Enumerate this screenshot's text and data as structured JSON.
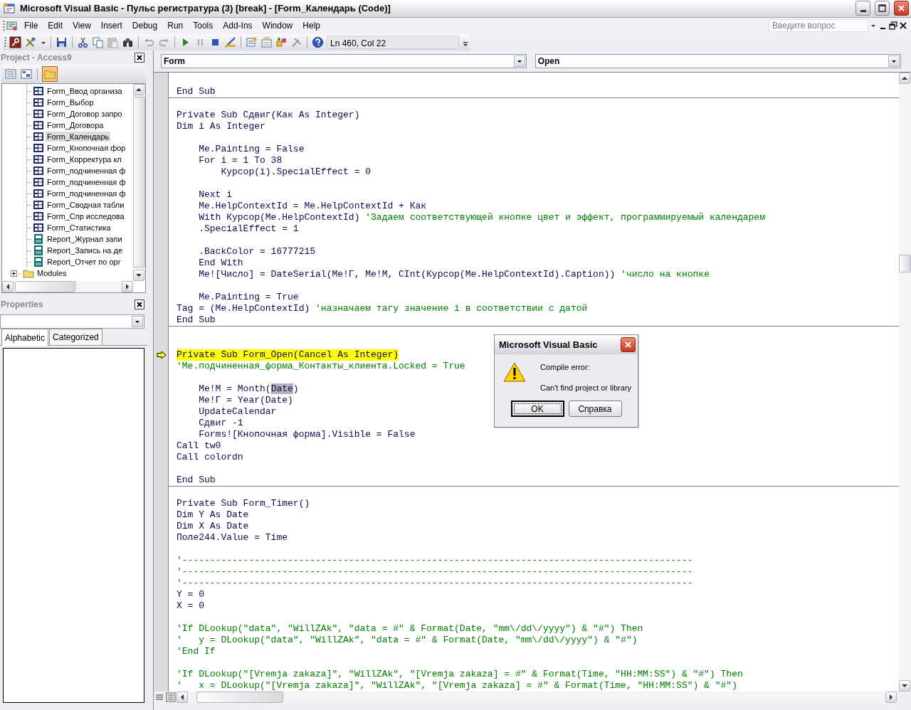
{
  "window": {
    "title": "Microsoft Visual Basic - Пульс регистратура (3) [break] - [Form_Календарь (Code)]"
  },
  "menu": [
    "File",
    "Edit",
    "View",
    "Insert",
    "Debug",
    "Run",
    "Tools",
    "Add-Ins",
    "Window",
    "Help"
  ],
  "help_search": {
    "placeholder": "Введите вопрос"
  },
  "toolbar": {
    "position": "Ln 460, Col 22"
  },
  "project_panel": {
    "title": "Project - Access9",
    "folders_toggled": true,
    "tree": [
      {
        "kind": "offscreen",
        "children": [
          {
            "kind": "form",
            "label": "Form_Ввод организа",
            "selected": false
          },
          {
            "kind": "form",
            "label": "Form_Выбор",
            "selected": false
          },
          {
            "kind": "form",
            "label": "Form_Договор запро",
            "selected": false
          },
          {
            "kind": "form",
            "label": "Form_Договора",
            "selected": false
          },
          {
            "kind": "form",
            "label": "Form_Календарь",
            "selected": true
          },
          {
            "kind": "form",
            "label": "Form_Кнопочная фор",
            "selected": false
          },
          {
            "kind": "form",
            "label": "Form_Корректура кл",
            "selected": false
          },
          {
            "kind": "form",
            "label": "Form_подчиненная ф",
            "selected": false
          },
          {
            "kind": "form",
            "label": "Form_подчиненная ф",
            "selected": false
          },
          {
            "kind": "form",
            "label": "Form_подчиненная ф",
            "selected": false
          },
          {
            "kind": "form",
            "label": "Form_Сводная табли",
            "selected": false
          },
          {
            "kind": "form",
            "label": "Form_Спр исследова",
            "selected": false
          },
          {
            "kind": "form",
            "label": "Form_Статистика",
            "selected": false
          },
          {
            "kind": "report",
            "label": "Report_Журнал запи",
            "selected": false
          },
          {
            "kind": "report",
            "label": "Report_Запись на де",
            "selected": false
          },
          {
            "kind": "report",
            "label": "Report_Отчет по орг",
            "selected": false
          }
        ]
      },
      {
        "kind": "folder",
        "label": "Modules",
        "expanded": false,
        "selected": false
      }
    ]
  },
  "properties_panel": {
    "title": "Properties",
    "tabs": [
      {
        "label": "Alphabetic",
        "selected": true
      },
      {
        "label": "Categorized",
        "selected": false
      }
    ]
  },
  "code_window": {
    "object": "Form",
    "procedure": "Open",
    "procedures": [
      {
        "lines": [
          {
            "kind": "blank"
          },
          {
            "kind": "statement",
            "parts": [
              {
                "kind": "code",
                "text": "End Sub"
              }
            ]
          }
        ]
      },
      {
        "lines": [
          {
            "kind": "blank"
          },
          {
            "kind": "statement",
            "parts": [
              {
                "kind": "code",
                "text": "Private Sub Сдвиг(Как As Integer)"
              }
            ]
          },
          {
            "kind": "statement",
            "parts": [
              {
                "kind": "code",
                "text": "Dim i As Integer"
              }
            ]
          },
          {
            "kind": "blank"
          },
          {
            "kind": "statement",
            "parts": [
              {
                "kind": "code",
                "text": "    Me.Painting = False"
              }
            ]
          },
          {
            "kind": "statement",
            "parts": [
              {
                "kind": "code",
                "text": "    For i = 1 To 38"
              }
            ]
          },
          {
            "kind": "statement",
            "parts": [
              {
                "kind": "code",
                "text": "        Курсор(i).SpecialEffect = 0"
              }
            ]
          },
          {
            "kind": "blank"
          },
          {
            "kind": "statement",
            "parts": [
              {
                "kind": "code",
                "text": "    Next i"
              }
            ]
          },
          {
            "kind": "statement",
            "parts": [
              {
                "kind": "code",
                "text": "    Me.HelpContextId = Me.HelpContextId + Как"
              }
            ]
          },
          {
            "kind": "statement",
            "parts": [
              {
                "kind": "code",
                "text": "    With Курсор(Me.HelpContextId)"
              },
              {
                "kind": "comment",
                "text": "'Задаем соответствующей кнопке цвет и эффект, программируемый календарем"
              }
            ]
          },
          {
            "kind": "statement",
            "parts": [
              {
                "kind": "code",
                "text": "    .SpecialEffect = 1"
              }
            ]
          },
          {
            "kind": "blank"
          },
          {
            "kind": "statement",
            "parts": [
              {
                "kind": "code",
                "text": "    .BackColor = 16777215"
              }
            ]
          },
          {
            "kind": "statement",
            "parts": [
              {
                "kind": "code",
                "text": "    End With"
              }
            ]
          },
          {
            "kind": "statement",
            "parts": [
              {
                "kind": "code",
                "text": "    Me![Число] = DateSerial(Me!Г, Me!М, CInt(Курсор(Me.HelpContextId).Caption))"
              },
              {
                "kind": "comment",
                "text": "'число на кнопке"
              }
            ]
          },
          {
            "kind": "blank"
          },
          {
            "kind": "statement",
            "parts": [
              {
                "kind": "code",
                "text": "    Me.Painting = True"
              }
            ]
          },
          {
            "kind": "statement",
            "parts": [
              {
                "kind": "code",
                "text": "Tag = (Me.HelpContextId)"
              },
              {
                "kind": "comment",
                "text": "'назначаем тагу значение i в соответствии с датой"
              }
            ]
          },
          {
            "kind": "statement",
            "parts": [
              {
                "kind": "code",
                "text": "End Sub"
              }
            ]
          }
        ]
      },
      {
        "lines": [
          {
            "kind": "blank"
          },
          {
            "kind": "blank"
          },
          {
            "kind": "current",
            "parts": [
              {
                "kind": "code",
                "text": "Private Sub Form_Open(Cancel As Integer)"
              }
            ]
          },
          {
            "kind": "statement",
            "parts": [
              {
                "kind": "comment",
                "text": "'Ме.подчиненная_форма_Контакты_клиента.Locked = True"
              }
            ]
          },
          {
            "kind": "blank"
          },
          {
            "kind": "statement",
            "parts": [
              {
                "kind": "code",
                "text": "    Me!М = Month("
              },
              {
                "kind": "selection",
                "text": "Date"
              },
              {
                "kind": "code",
                "text": ")"
              }
            ]
          },
          {
            "kind": "statement",
            "parts": [
              {
                "kind": "code",
                "text": "    Me!Г = Year(Date)"
              }
            ]
          },
          {
            "kind": "statement",
            "parts": [
              {
                "kind": "code",
                "text": "    UpdateCalendar"
              }
            ]
          },
          {
            "kind": "statement",
            "parts": [
              {
                "kind": "code",
                "text": "    Сдвиг -1"
              }
            ]
          },
          {
            "kind": "statement",
            "parts": [
              {
                "kind": "code",
                "text": "    Forms![Кнопочная форма].Visible = False"
              }
            ]
          },
          {
            "kind": "statement",
            "parts": [
              {
                "kind": "code",
                "text": "Call tw0"
              }
            ]
          },
          {
            "kind": "statement",
            "parts": [
              {
                "kind": "code",
                "text": "Call colordn"
              }
            ]
          },
          {
            "kind": "blank"
          },
          {
            "kind": "statement",
            "parts": [
              {
                "kind": "code",
                "text": "End Sub"
              }
            ]
          }
        ]
      },
      {
        "lines": [
          {
            "kind": "blank"
          },
          {
            "kind": "statement",
            "parts": [
              {
                "kind": "code",
                "text": "Private Sub Form_Timer()"
              }
            ]
          },
          {
            "kind": "statement",
            "parts": [
              {
                "kind": "code",
                "text": "Dim Y As Date"
              }
            ]
          },
          {
            "kind": "statement",
            "parts": [
              {
                "kind": "code",
                "text": "Dim X As Date"
              }
            ]
          },
          {
            "kind": "statement",
            "parts": [
              {
                "kind": "code",
                "text": "Поле244.Value = Time"
              }
            ]
          },
          {
            "kind": "blank"
          },
          {
            "kind": "statement",
            "parts": [
              {
                "kind": "comment",
                "text": "'--------------------------------------------------------------------------------------------"
              }
            ]
          },
          {
            "kind": "statement",
            "parts": [
              {
                "kind": "comment",
                "text": "'--------------------------------------------------------------------------------------------"
              }
            ]
          },
          {
            "kind": "statement",
            "parts": [
              {
                "kind": "comment",
                "text": "'--------------------------------------------------------------------------------------------"
              }
            ]
          },
          {
            "kind": "statement",
            "parts": [
              {
                "kind": "code",
                "text": "Y = 0"
              }
            ]
          },
          {
            "kind": "statement",
            "parts": [
              {
                "kind": "code",
                "text": "X = 0"
              }
            ]
          },
          {
            "kind": "blank"
          },
          {
            "kind": "statement",
            "parts": [
              {
                "kind": "comment",
                "text": "'If DLookup(\"data\", \"WillZAk\", \"data = #\" & Format(Date, \"mm\\/dd\\/yyyy\") & \"#\") Then"
              }
            ]
          },
          {
            "kind": "statement",
            "parts": [
              {
                "kind": "comment",
                "text": "'   y = DLookup(\"data\", \"WillZAk\", \"data = #\" & Format(Date, \"mm\\/dd\\/yyyy\") & \"#\")"
              }
            ]
          },
          {
            "kind": "statement",
            "parts": [
              {
                "kind": "comment",
                "text": "'End If"
              }
            ]
          },
          {
            "kind": "blank"
          },
          {
            "kind": "statement",
            "parts": [
              {
                "kind": "comment",
                "text": "'If DLookup(\"[Vremja zakaza]\", \"WillZAk\", \"[Vremja zakaza] = #\" & Format(Time, \"HH:MM:SS\") & \"#\") Then"
              }
            ]
          },
          {
            "kind": "statement",
            "parts": [
              {
                "kind": "comment",
                "text": "'   x = DLookup(\"[Vremja zakaza]\", \"WillZAk\", \"[Vremja zakaza] = #\" & Format(Time, \"HH:MM:SS\") & \"#\")"
              }
            ]
          }
        ]
      }
    ]
  },
  "dialog": {
    "title": "Microsoft Visual Basic",
    "heading": "Compile error:",
    "message": "Can't find project or library",
    "buttons": [
      {
        "label": "OK",
        "default": true
      },
      {
        "label": "Справка",
        "default": false
      }
    ]
  }
}
